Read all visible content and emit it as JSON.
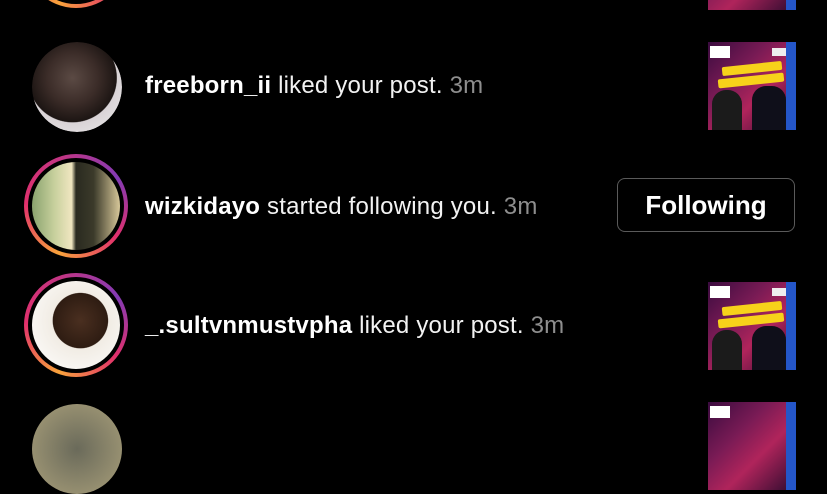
{
  "notifications": [
    {
      "username": "freeborn_ii",
      "action": " liked your post.",
      "time": "3m",
      "type": "like",
      "avatar_ring": false
    },
    {
      "username": "wizkidayo",
      "action": " started following you.",
      "time": "3m",
      "type": "follow",
      "avatar_ring": true,
      "button_label": "Following"
    },
    {
      "username": "_.sultvnmustvpha",
      "action": " liked your post.",
      "time": "3m",
      "type": "like",
      "avatar_ring": true
    }
  ],
  "colors": {
    "background": "#000000",
    "text": "#ffffff",
    "timestamp": "#8e8e8e",
    "button_border": "#5a5a5a",
    "story_ring": [
      "#f9a23b",
      "#e1306c",
      "#833ab4"
    ]
  }
}
